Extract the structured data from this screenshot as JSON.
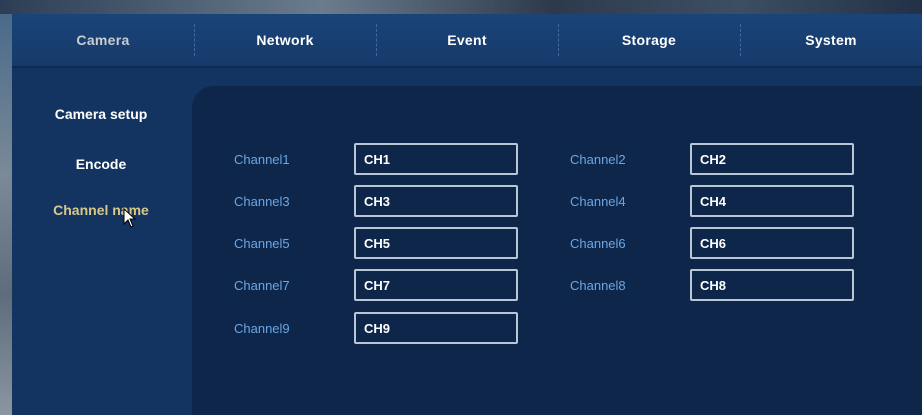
{
  "tabs": [
    {
      "label": "Camera",
      "active": true
    },
    {
      "label": "Network",
      "active": false
    },
    {
      "label": "Event",
      "active": false
    },
    {
      "label": "Storage",
      "active": false
    },
    {
      "label": "System",
      "active": false
    }
  ],
  "sidebar": {
    "items": [
      {
        "label": "Camera setup",
        "active": false
      },
      {
        "label": "Encode",
        "active": false
      },
      {
        "label": "Channel name",
        "active": true
      }
    ]
  },
  "channels": [
    {
      "label": "Channel1",
      "value": "CH1"
    },
    {
      "label": "Channel2",
      "value": "CH2"
    },
    {
      "label": "Channel3",
      "value": "CH3"
    },
    {
      "label": "Channel4",
      "value": "CH4"
    },
    {
      "label": "Channel5",
      "value": "CH5"
    },
    {
      "label": "Channel6",
      "value": "CH6"
    },
    {
      "label": "Channel7",
      "value": "CH7"
    },
    {
      "label": "Channel8",
      "value": "CH8"
    },
    {
      "label": "Channel9",
      "value": "CH9"
    }
  ],
  "colors": {
    "panel": "#133461",
    "content": "#0d2649",
    "label": "#6aa7e3",
    "active_sidebar": "#d8c887",
    "input_border": "#b9c6d6"
  },
  "icons": {
    "cursor": "mouse-pointer-icon"
  }
}
